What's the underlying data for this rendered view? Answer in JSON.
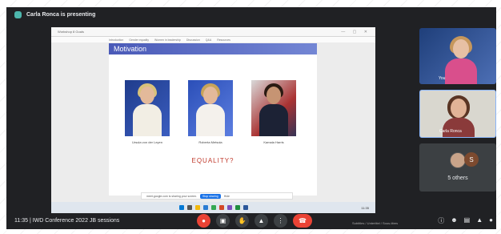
{
  "presenting": {
    "text": "Carla Ronca is presenting"
  },
  "screen": {
    "browser_tab": "Workshop 8 Goals",
    "menu": [
      "Introduction",
      "Gender equality",
      "Women in leadership",
      "Discussion",
      "Q&A",
      "Resources"
    ],
    "slide": {
      "title": "Motivation",
      "portraits": [
        {
          "caption": "Ursula von der Leyen"
        },
        {
          "caption": "Roberta Metsola"
        },
        {
          "caption": "Kamala Harris"
        }
      ],
      "tagline": "EQUALITY?"
    },
    "notice": {
      "text": "meet.google.com is sharing your screen.",
      "stop": "Stop sharing",
      "hide": "Hide"
    },
    "clock": "11:35"
  },
  "participants": {
    "tile1_name": "You",
    "tile2_name": "Carla Ronca",
    "others": {
      "label": "5 others",
      "initial": "S"
    }
  },
  "bottom": {
    "time_and_title": "11:35 | IWD Conference 2022 JB sessions",
    "captions_hint": "Subtitles / Untertitel / Sous-titres"
  },
  "colors": {
    "meet_bg": "#202124",
    "end_call": "#ea4335",
    "slide_header": "#4a5ab8",
    "equality": "#c0392b"
  },
  "icons": [
    "mic-off-icon",
    "camera-icon",
    "hand-icon",
    "present-icon",
    "more-icon",
    "end-call-icon",
    "info-icon",
    "people-icon",
    "chat-icon",
    "activities-icon",
    "lock-icon"
  ]
}
